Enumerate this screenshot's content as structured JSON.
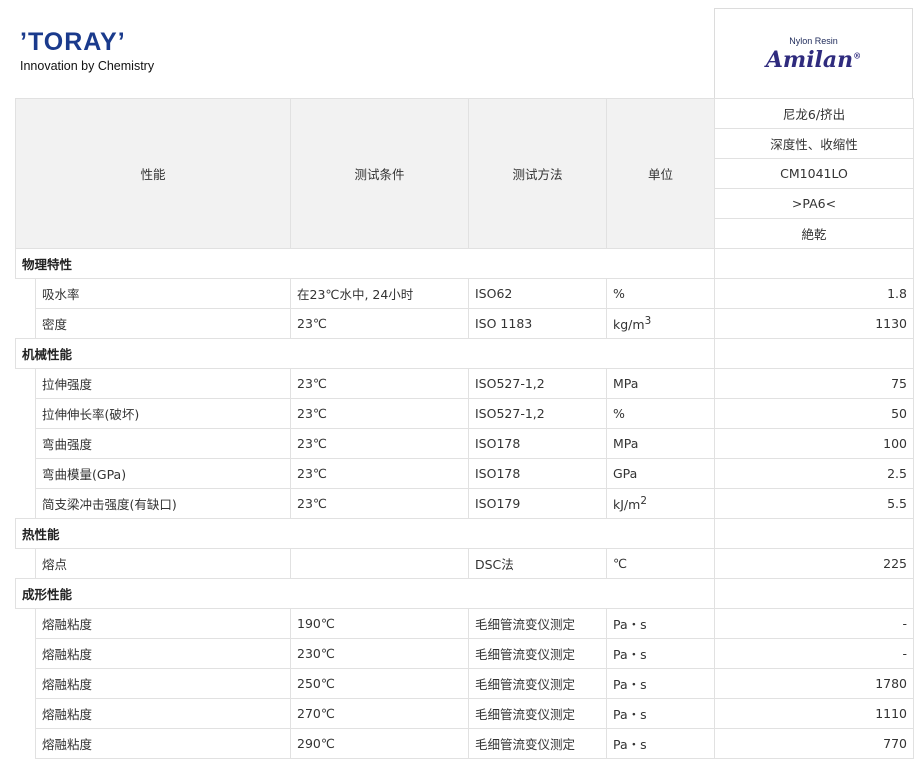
{
  "brand": {
    "name": "’TORAY’",
    "tagline": "Innovation by Chemistry"
  },
  "product_logo": {
    "small": "Nylon Resin",
    "name": "Amilan",
    "mark": "®"
  },
  "header": {
    "col1": "性能",
    "col2": "测试条件",
    "col3": "测试方法",
    "col4": "单位",
    "product_lines": [
      "尼龙6/挤出",
      "深度性、收缩性",
      "CM1041LO",
      ">PA6<",
      "絶乾"
    ]
  },
  "sections": [
    {
      "title": "物理特性",
      "rows": [
        {
          "name": "吸水率",
          "cond": "在23℃水中, 24小时",
          "method": "ISO62",
          "unit": "%",
          "value": "1.8"
        },
        {
          "name": "密度",
          "cond": "23℃",
          "method": "ISO 1183",
          "unit": "kg/m",
          "unit_sup": "3",
          "value": "1130"
        }
      ]
    },
    {
      "title": "机械性能",
      "rows": [
        {
          "name": "拉伸强度",
          "cond": "23℃",
          "method": "ISO527-1,2",
          "unit": "MPa",
          "value": "75"
        },
        {
          "name": "拉伸伸长率(破坏)",
          "cond": "23℃",
          "method": "ISO527-1,2",
          "unit": "%",
          "value": "50"
        },
        {
          "name": "弯曲强度",
          "cond": "23℃",
          "method": "ISO178",
          "unit": "MPa",
          "value": "100"
        },
        {
          "name": "弯曲模量(GPa)",
          "cond": "23℃",
          "method": "ISO178",
          "unit": "GPa",
          "value": "2.5"
        },
        {
          "name": "简支梁冲击强度(有缺口)",
          "cond": "23℃",
          "method": "ISO179",
          "unit": "kJ/m",
          "unit_sup": "2",
          "value": "5.5"
        }
      ]
    },
    {
      "title": "热性能",
      "rows": [
        {
          "name": "熔点",
          "cond": "",
          "method": "DSC法",
          "unit": "℃",
          "value": "225"
        }
      ]
    },
    {
      "title": "成形性能",
      "rows": [
        {
          "name": "熔融粘度",
          "cond": "190℃",
          "method": "毛细管流变仪测定",
          "unit": "Pa・s",
          "value": "-"
        },
        {
          "name": "熔融粘度",
          "cond": "230℃",
          "method": "毛细管流变仪测定",
          "unit": "Pa・s",
          "value": "-"
        },
        {
          "name": "熔融粘度",
          "cond": "250℃",
          "method": "毛细管流变仪测定",
          "unit": "Pa・s",
          "value": "1780"
        },
        {
          "name": "熔融粘度",
          "cond": "270℃",
          "method": "毛细管流变仪测定",
          "unit": "Pa・s",
          "value": "1110"
        },
        {
          "name": "熔融粘度",
          "cond": "290℃",
          "method": "毛细管流变仪测定",
          "unit": "Pa・s",
          "value": "770"
        }
      ]
    }
  ]
}
